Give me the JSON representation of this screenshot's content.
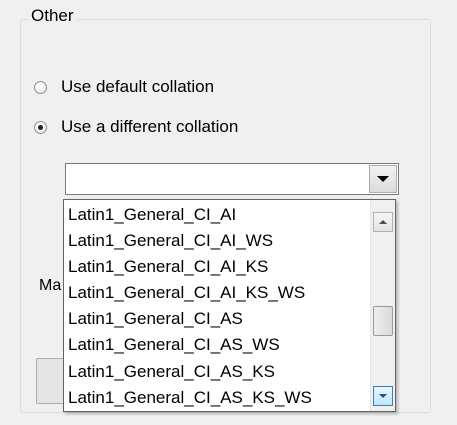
{
  "groupbox": {
    "title": "Other"
  },
  "radios": {
    "default_label": "Use default collation",
    "different_label": "Use a different collation",
    "selected": "different"
  },
  "combo": {
    "value": ""
  },
  "background": {
    "partial_label": "Ma"
  },
  "dropdown": {
    "items": [
      "Latin1_General_CI_AI",
      "Latin1_General_CI_AI_WS",
      "Latin1_General_CI_AI_KS",
      "Latin1_General_CI_AI_KS_WS",
      "Latin1_General_CI_AS",
      "Latin1_General_CI_AS_WS",
      "Latin1_General_CI_AS_KS",
      "Latin1_General_CI_AS_KS_WS"
    ],
    "scroll_up_icon": "triangle-up",
    "scroll_down_icon": "triangle-down"
  }
}
